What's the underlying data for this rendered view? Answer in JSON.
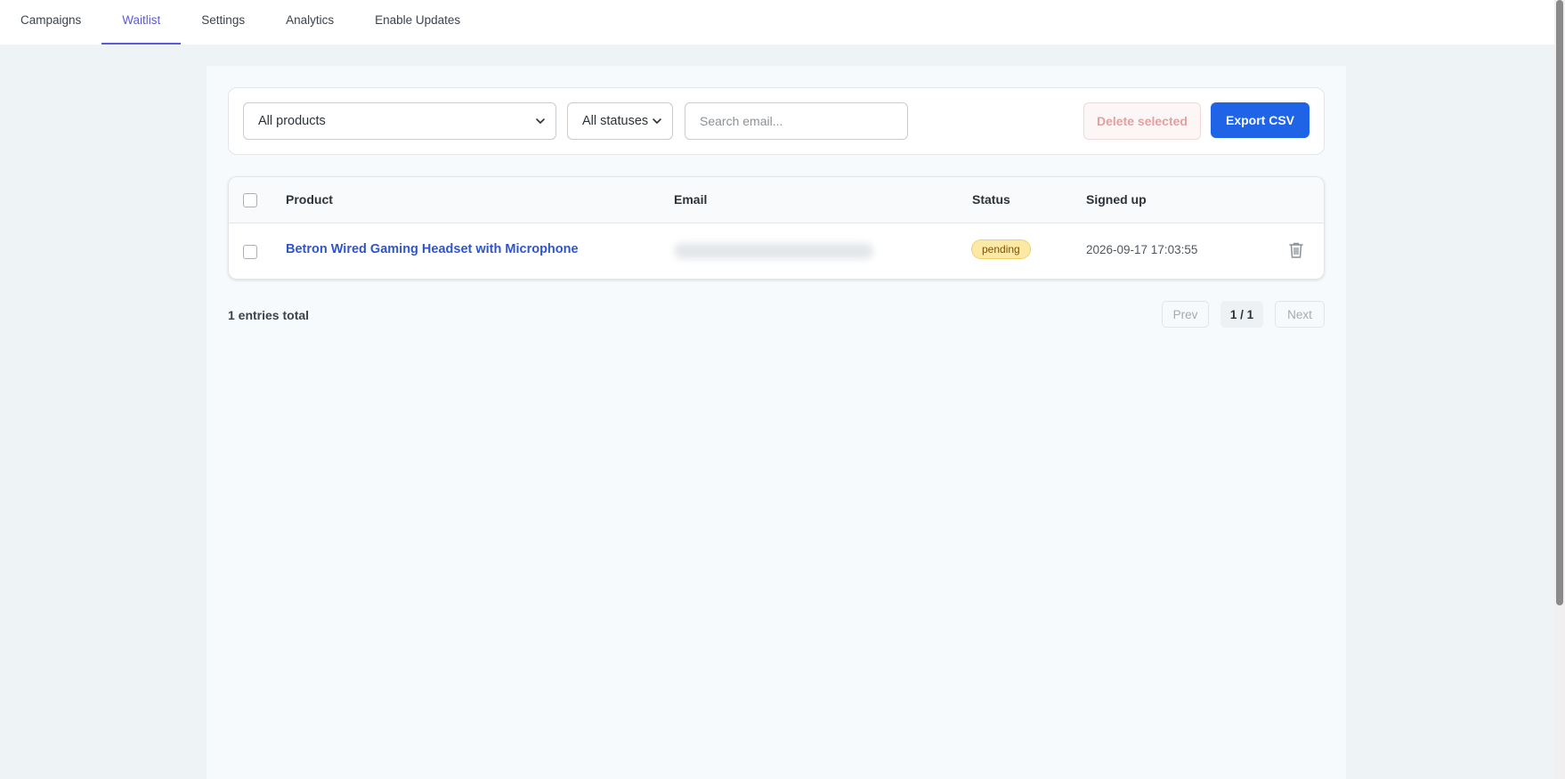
{
  "nav": {
    "tabs": [
      {
        "label": "Campaigns"
      },
      {
        "label": "Waitlist"
      },
      {
        "label": "Settings"
      },
      {
        "label": "Analytics"
      },
      {
        "label": "Enable Updates"
      }
    ],
    "active_tab": "Waitlist"
  },
  "filters": {
    "product_select": "All products",
    "status_select": "All statuses",
    "search_placeholder": "Search email...",
    "delete_label": "Delete selected",
    "export_label": "Export CSV"
  },
  "table": {
    "headers": {
      "product": "Product",
      "email": "Email",
      "status": "Status",
      "signed_up": "Signed up"
    },
    "rows": [
      {
        "product": "Betron Wired Gaming Headset with Microphone",
        "status": "pending",
        "signed_up": "2026-09-17 17:03:55",
        "delete_icon": "trash-icon"
      }
    ]
  },
  "footer": {
    "total": "1 entries total",
    "prev": "Prev",
    "page": "1 / 1",
    "next": "Next"
  },
  "colors": {
    "accent": "#5b5bd6",
    "primary_button": "#1f63e6",
    "link": "#2f55c9",
    "pending_badge": "#fde9a6"
  }
}
